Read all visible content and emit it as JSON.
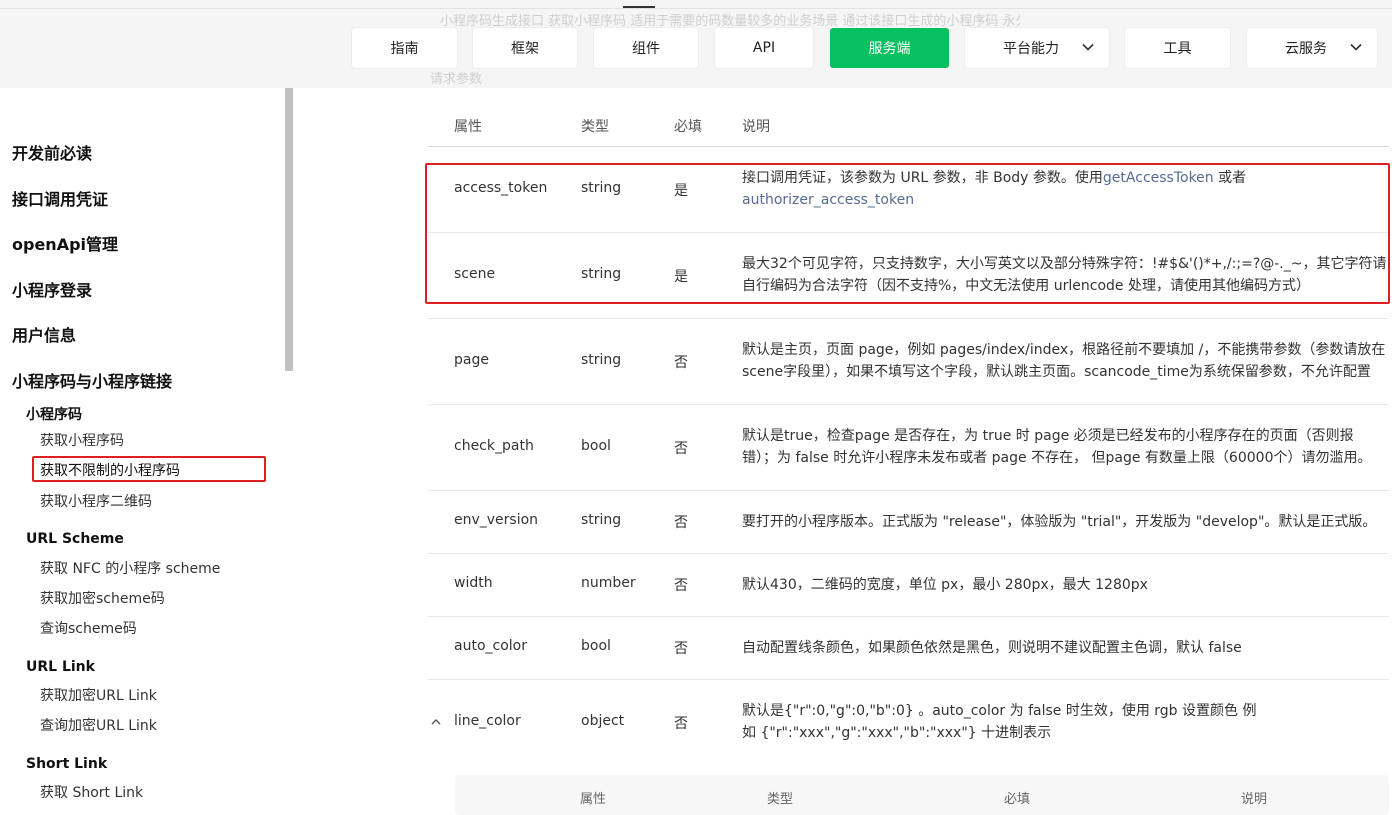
{
  "nav": {
    "ghost_text": "小程序码生成接口 获取小程序码 适用于需要的码数量较多的业务场景 通过该接口生成的小程序码 永久有效",
    "ghost_label": "请求参数",
    "items": [
      {
        "label": "指南"
      },
      {
        "label": "框架"
      },
      {
        "label": "组件"
      },
      {
        "label": "API"
      },
      {
        "label": "服务端"
      },
      {
        "label": "平台能力"
      },
      {
        "label": "工具"
      },
      {
        "label": "云服务"
      }
    ],
    "active_color": "#07c160"
  },
  "sidebar": {
    "top_items": [
      "开发前必读",
      "接口调用凭证",
      "openApi管理",
      "小程序登录",
      "用户信息",
      "小程序码与小程序链接"
    ],
    "sections": [
      {
        "title": "小程序码",
        "items": [
          "获取小程序码",
          "获取不限制的小程序码",
          "获取小程序二维码"
        ]
      },
      {
        "title": "URL Scheme",
        "items": [
          "获取 NFC 的小程序 scheme",
          "获取加密scheme码",
          "查询scheme码"
        ]
      },
      {
        "title": "URL Link",
        "items": [
          "获取加密URL Link",
          "查询加密URL Link"
        ]
      },
      {
        "title": "Short Link",
        "items": [
          "获取 Short Link"
        ]
      }
    ],
    "highlighted_item": "获取不限制的小程序码"
  },
  "table": {
    "headers": [
      "属性",
      "类型",
      "必填",
      "说明"
    ],
    "rows": [
      {
        "name": "access_token",
        "type": "string",
        "required": "是",
        "desc_pre": "接口调用凭证，该参数为 URL 参数，非 Body 参数。使用",
        "desc_link1": "getAccessToken",
        "desc_mid": " 或者",
        "desc_link2": "authorizer_access_token"
      },
      {
        "name": "scene",
        "type": "string",
        "required": "是",
        "desc": "最大32个可见字符，只支持数字，大小写英文以及部分特殊字符：!#$&'()*+,/:;=?@-._~，其它字符请自行编码为合法字符（因不支持%，中文无法使用 urlencode 处理，请使用其他编码方式）"
      },
      {
        "name": "page",
        "type": "string",
        "required": "否",
        "desc": "默认是主页，页面 page，例如 pages/index/index，根路径前不要填加 /，不能携带参数（参数请放在scene字段里），如果不填写这个字段，默认跳主页面。scancode_time为系统保留参数，不允许配置"
      },
      {
        "name": "check_path",
        "type": "bool",
        "required": "否",
        "desc": "默认是true，检查page 是否存在，为 true 时 page 必须是已经发布的小程序存在的页面（否则报错）；为 false 时允许小程序未发布或者 page 不存在， 但page 有数量上限（60000个）请勿滥用。"
      },
      {
        "name": "env_version",
        "type": "string",
        "required": "否",
        "desc": "要打开的小程序版本。正式版为 \"release\"，体验版为 \"trial\"，开发版为 \"develop\"。默认是正式版。"
      },
      {
        "name": "width",
        "type": "number",
        "required": "否",
        "desc": "默认430，二维码的宽度，单位 px，最小 280px，最大 1280px"
      },
      {
        "name": "auto_color",
        "type": "bool",
        "required": "否",
        "desc": "自动配置线条颜色，如果颜色依然是黑色，则说明不建议配置主色调，默认 false"
      },
      {
        "name": "line_color",
        "type": "object",
        "required": "否",
        "desc": "默认是{\"r\":0,\"g\":0,\"b\":0} 。auto_color 为 false 时生效，使用 rgb 设置颜色 例如 {\"r\":\"xxx\",\"g\":\"xxx\",\"b\":\"xxx\"} 十进制表示"
      }
    ],
    "sub_headers": [
      "属性",
      "类型",
      "必填",
      "说明"
    ]
  }
}
